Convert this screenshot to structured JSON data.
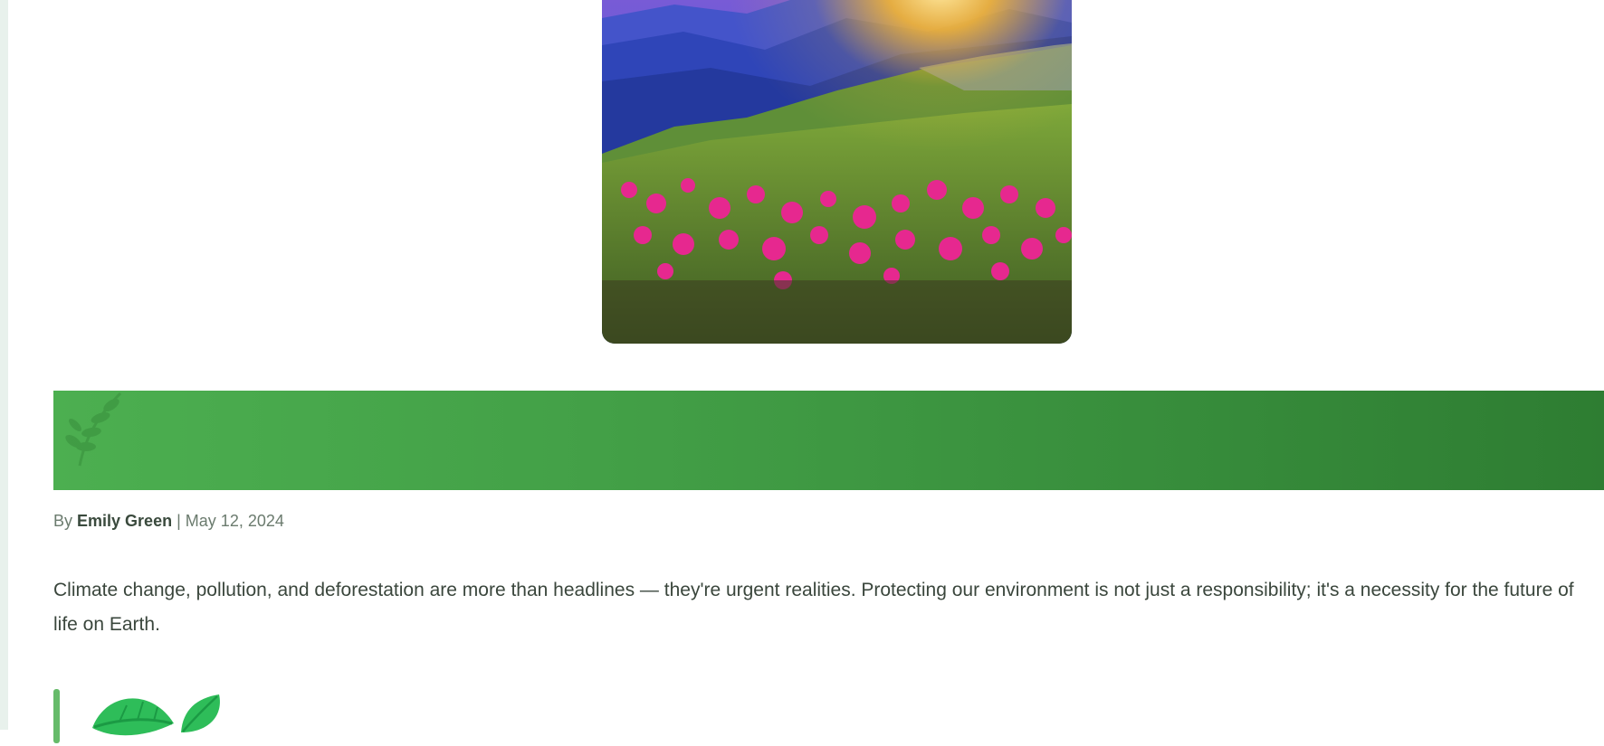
{
  "hero": {
    "image_alt": "Mountain meadow with pink flowers at sunrise"
  },
  "banner": {
    "accent_start": "#4caf50",
    "accent_end": "#2e7d32",
    "icon": "leaf-sprig-icon"
  },
  "byline": {
    "prefix": "By",
    "author": "Emily Green",
    "separator": "|",
    "date": "May 12, 2024"
  },
  "article": {
    "intro": "Climate change, pollution, and deforestation are more than headlines — they're urgent realities. Protecting our environment is not just a responsibility; it's a necessity for the future of life on Earth."
  },
  "quote": {
    "icon": "green-leaves-icon",
    "bar_color": "#66bb6a"
  }
}
